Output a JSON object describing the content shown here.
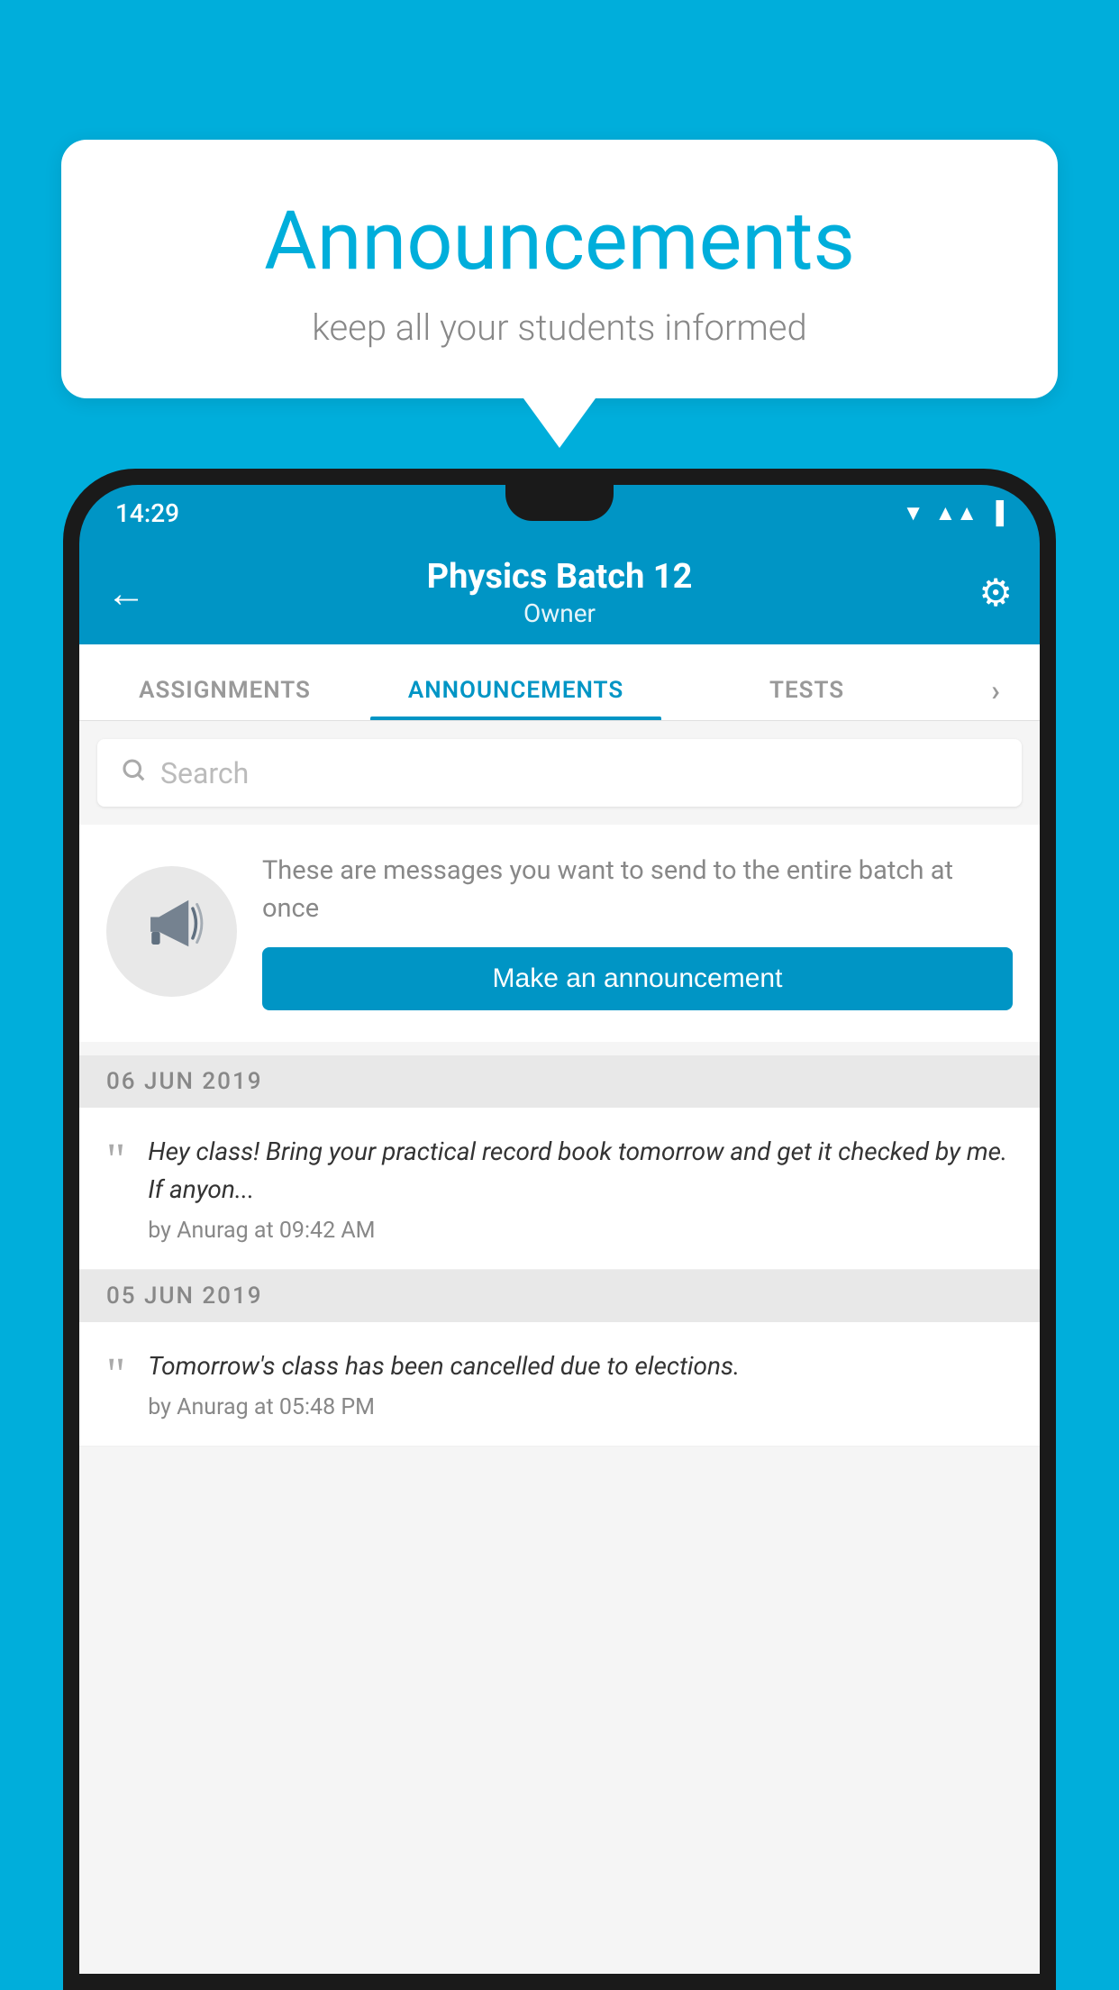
{
  "background_color": "#00AEDB",
  "speech_bubble": {
    "title": "Announcements",
    "subtitle": "keep all your students informed"
  },
  "phone": {
    "status_bar": {
      "time": "14:29",
      "icons": [
        "wifi",
        "signal",
        "battery"
      ]
    },
    "app_bar": {
      "back_label": "←",
      "title": "Physics Batch 12",
      "subtitle": "Owner",
      "settings_icon": "⚙"
    },
    "tabs": [
      {
        "label": "ASSIGNMENTS",
        "active": false
      },
      {
        "label": "ANNOUNCEMENTS",
        "active": true
      },
      {
        "label": "TESTS",
        "active": false
      },
      {
        "label": "•",
        "active": false
      }
    ],
    "search": {
      "placeholder": "Search"
    },
    "promo": {
      "description": "These are messages you want to send to the entire batch at once",
      "button_label": "Make an announcement"
    },
    "date_sections": [
      {
        "date": "06  JUN  2019",
        "announcements": [
          {
            "message": "Hey class! Bring your practical record book tomorrow and get it checked by me. If anyon...",
            "author": "by Anurag at 09:42 AM"
          }
        ]
      },
      {
        "date": "05  JUN  2019",
        "announcements": [
          {
            "message": "Tomorrow's class has been cancelled due to elections.",
            "author": "by Anurag at 05:48 PM"
          }
        ]
      }
    ]
  }
}
